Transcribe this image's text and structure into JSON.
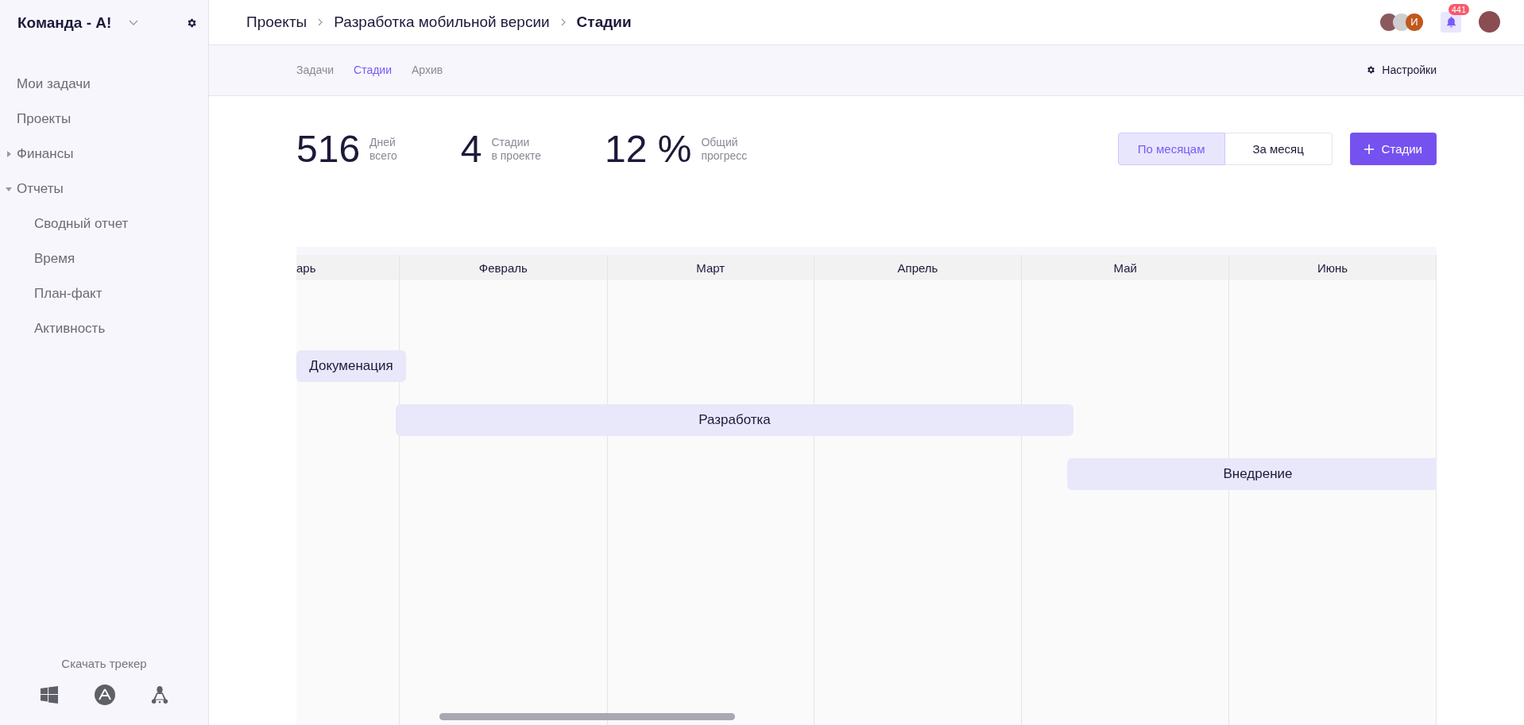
{
  "sidebar": {
    "team": "Команда - А!",
    "items": [
      {
        "label": "Мои задачи",
        "kind": "link"
      },
      {
        "label": "Проекты",
        "kind": "link"
      },
      {
        "label": "Финансы",
        "kind": "group",
        "expanded": false
      },
      {
        "label": "Отчеты",
        "kind": "group",
        "expanded": true,
        "children": [
          {
            "label": "Сводный отчет"
          },
          {
            "label": "Время"
          },
          {
            "label": "План-факт"
          },
          {
            "label": "Активность"
          }
        ]
      }
    ],
    "download": "Скачать трекер"
  },
  "breadcrumbs": [
    "Проекты",
    "Разработка мобильной версии",
    "Стадии"
  ],
  "header": {
    "avatar_initial": "И",
    "notifications": "441"
  },
  "tabs": [
    {
      "label": "Задачи",
      "selected": false
    },
    {
      "label": "Стадии",
      "selected": true
    },
    {
      "label": "Архив",
      "selected": false
    }
  ],
  "settings": "Настройки",
  "stats": [
    {
      "value": "516",
      "line1": "Дней",
      "line2": "всего"
    },
    {
      "value": "4",
      "line1": "Стадии",
      "line2": "в проекте"
    },
    {
      "value": "12 %",
      "line1": "Общий",
      "line2": "прогресс"
    }
  ],
  "view_toggle": [
    {
      "label": "По месяцам",
      "selected": true
    },
    {
      "label": "За месяц",
      "selected": false
    }
  ],
  "add_button": "Стадии",
  "gantt": {
    "months": [
      "арь",
      "Февраль",
      "Март",
      "Апрель",
      "Май",
      "Июнь"
    ],
    "stages": [
      "Докуменация",
      "Разработка",
      "Внедрение"
    ]
  }
}
